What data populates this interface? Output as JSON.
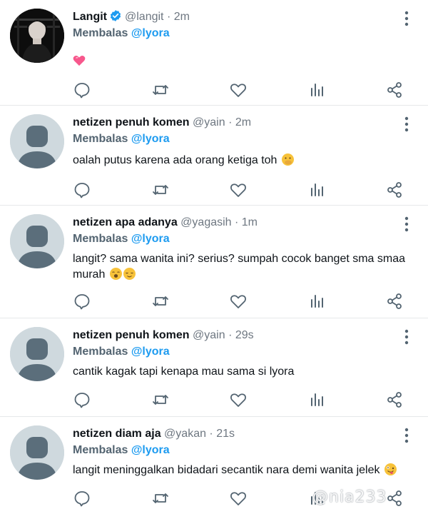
{
  "colors": {
    "link": "#1d9bf0",
    "verified": "#1d9bf0",
    "icon": "#536471",
    "heart_emoji": "#f7578c"
  },
  "tweets": [
    {
      "name": "Langit",
      "verified": true,
      "handle": "@langit",
      "time": "2m",
      "reply_prefix": "Membalas",
      "reply_to": "@lyora",
      "text": "",
      "emoji": "pink-heart",
      "avatar": "photo"
    },
    {
      "name": "netizen penuh komen",
      "verified": false,
      "handle": "@yain",
      "time": "2m",
      "reply_prefix": "Membalas",
      "reply_to": "@lyora",
      "text": "oalah putus karena ada orang ketiga toh",
      "emoji": "face-with-hand-over-mouth",
      "avatar": "default"
    },
    {
      "name": "netizen apa adanya",
      "verified": false,
      "handle": "@yagasih",
      "time": "1m",
      "reply_prefix": "Membalas",
      "reply_to": "@lyora",
      "text": "langit? sama wanita ini? serius? sumpah cocok banget sma smaa murah",
      "emoji": "yawning-and-relieved-faces",
      "avatar": "default"
    },
    {
      "name": "netizen penuh komen",
      "verified": false,
      "handle": "@yain",
      "time": "29s",
      "reply_prefix": "Membalas",
      "reply_to": "@lyora",
      "text": "cantik kagak tapi kenapa mau sama si lyora",
      "emoji": "",
      "avatar": "default"
    },
    {
      "name": "netizen diam aja",
      "verified": false,
      "handle": "@yakan",
      "time": "21s",
      "reply_prefix": "Membalas",
      "reply_to": "@lyora",
      "text": "langit meninggalkan bidadari secantik nara demi wanita jelek",
      "emoji": "zany-face",
      "avatar": "default"
    }
  ],
  "separator": " · ",
  "watermark": "@nia233"
}
